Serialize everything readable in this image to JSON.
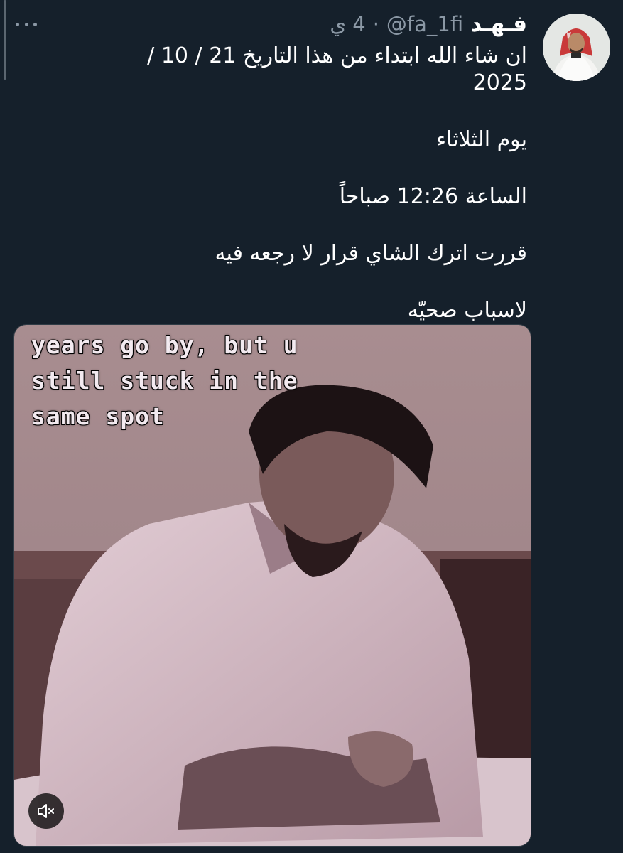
{
  "tweet": {
    "display_name": "فـهـد",
    "handle": "@fa_1fi",
    "separator": "·",
    "time": "4 ي",
    "lines": [
      "ان شاء الله ابتداء من هذا التاريخ  21 / 10 / 2025",
      "يوم الثلاثاء",
      "الساعة 12:26 صباحاً",
      "قررت اترك الشاي قرار لا رجعه فيه",
      "لاسباب صحيّه"
    ]
  },
  "media": {
    "caption": "years go by, but u\nstill stuck in the\nsame spot",
    "mute_icon": "speaker-muted-icon"
  },
  "colors": {
    "background": "#15202b",
    "secondary_text": "#8b98a5",
    "primary_text": "#ffffff"
  }
}
